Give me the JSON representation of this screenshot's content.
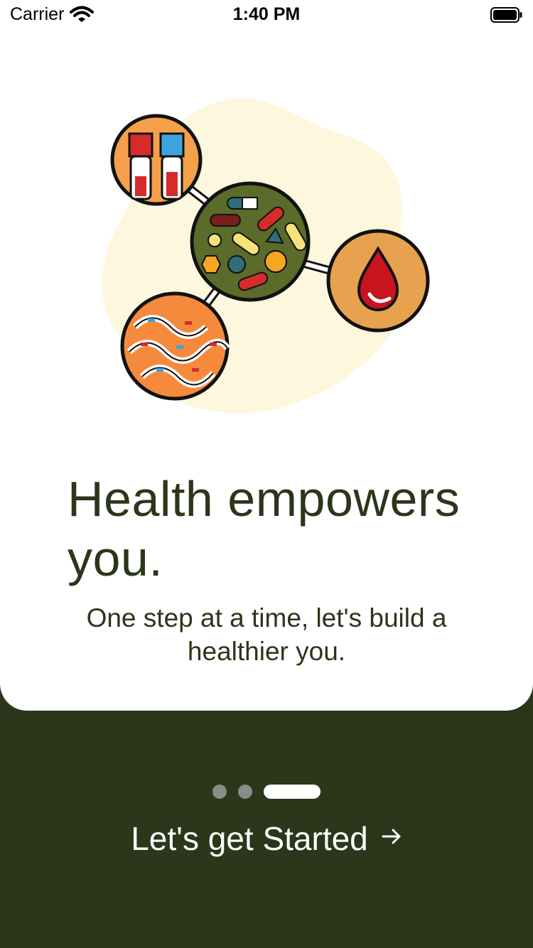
{
  "status_bar": {
    "carrier": "Carrier",
    "time": "1:40 PM"
  },
  "onboarding": {
    "headline": "Health empowers you.",
    "subtitle": "One step at a time, let's build a healthier you.",
    "cta_label": "Let's get Started",
    "cta_icon": "arrow-right-icon",
    "pager": {
      "total": 3,
      "active_index": 2
    }
  },
  "colors": {
    "brand_dark": "#2b361a",
    "card_bg": "#ffffff",
    "dot_inactive": "#8b8c87",
    "dot_active": "#ffffff"
  }
}
